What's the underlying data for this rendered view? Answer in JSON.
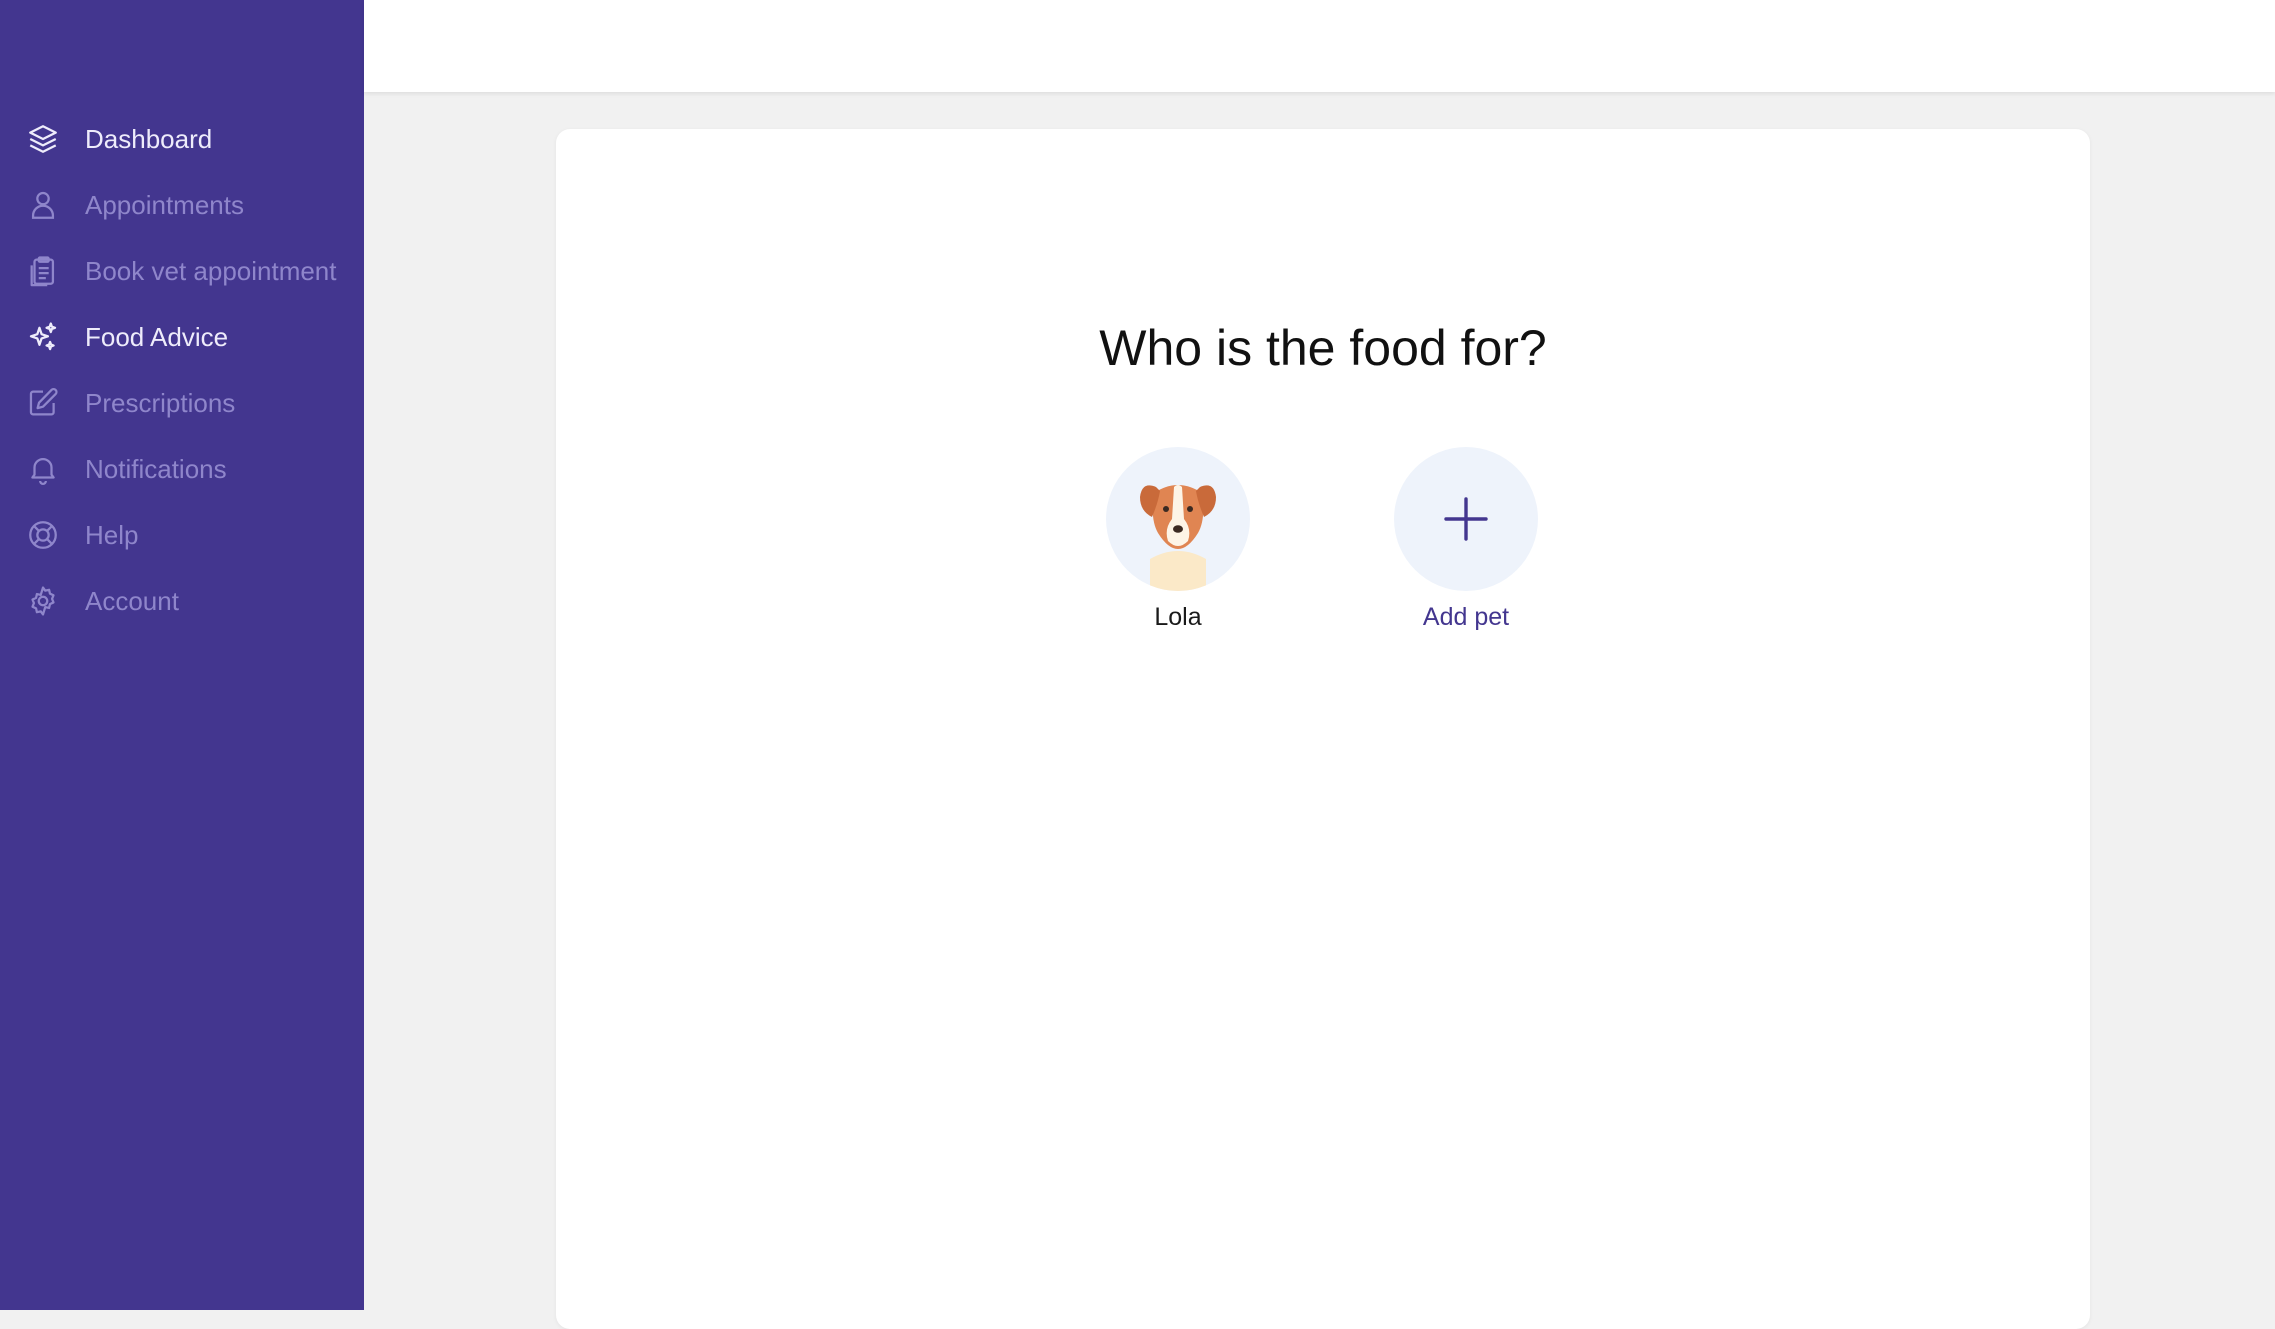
{
  "sidebar": {
    "items": [
      {
        "label": "Dashboard",
        "icon": "layers-icon"
      },
      {
        "label": "Appointments",
        "icon": "user-icon"
      },
      {
        "label": "Book vet appointment",
        "icon": "clipboard-icon"
      },
      {
        "label": "Food Advice",
        "icon": "sparkles-icon"
      },
      {
        "label": "Prescriptions",
        "icon": "edit-icon"
      },
      {
        "label": "Notifications",
        "icon": "bell-icon"
      },
      {
        "label": "Help",
        "icon": "lifebuoy-icon"
      },
      {
        "label": "Account",
        "icon": "gear-icon"
      }
    ]
  },
  "main": {
    "title": "Who is the food for?",
    "pets": [
      {
        "name": "Lola",
        "icon": "dog-avatar"
      }
    ],
    "add_pet_label": "Add pet"
  },
  "colors": {
    "sidebar_bg": "#43368f",
    "nav_inactive": "#8f86cb",
    "nav_active": "#eeecfb",
    "accent": "#43368f",
    "avatar_bg": "#eef3fb"
  }
}
